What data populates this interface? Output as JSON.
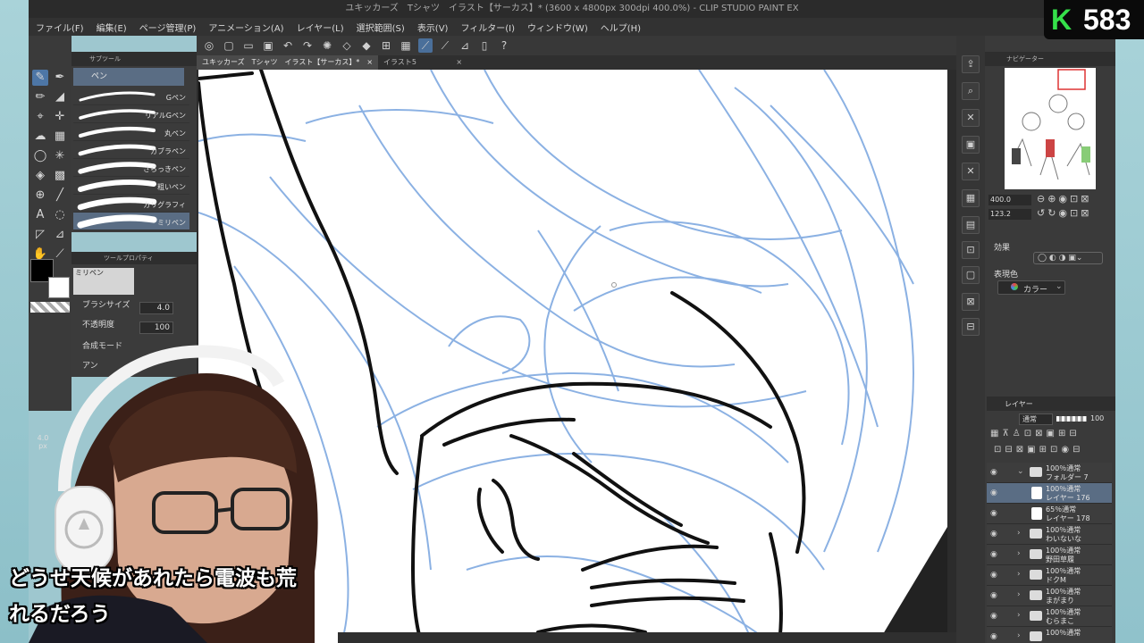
{
  "window": {
    "title": "ユキッカーズ　Tシャツ　イラスト【サーカス】* (3600 x 4800px 300dpi 400.0%)  - CLIP STUDIO PAINT EX"
  },
  "menu": [
    "ファイル(F)",
    "編集(E)",
    "ページ管理(P)",
    "アニメーション(A)",
    "レイヤー(L)",
    "選択範囲(S)",
    "表示(V)",
    "フィルター(I)",
    "ウィンドウ(W)",
    "ヘルプ(H)"
  ],
  "tabs": [
    {
      "label": "ユキッカーズ　Tシャツ　イラスト【サーカス】*",
      "close": "×"
    },
    {
      "label": "イラスト5",
      "close": "×"
    }
  ],
  "subtool": {
    "header": "サブツール",
    "group": "ペン",
    "brushes": [
      "Gペン",
      "リアルGペン",
      "丸ペン",
      "カブラペン",
      "さらっきペン",
      "粗いペン",
      "カリグラフィ",
      "ミリペン"
    ]
  },
  "toolprop": {
    "header": "ツールプロパティ",
    "preset": "ミリペン",
    "brush_size_label": "ブラシサイズ",
    "brush_size_value": "4.0",
    "opacity_label": "不透明度",
    "opacity_value": "100",
    "blend_label": "合成モード",
    "aa_label": "アン"
  },
  "size_readout": "4.0",
  "size_unit": "px",
  "navigator": {
    "header": "ナビゲーター",
    "zoom": "400.0",
    "rotate": "123.2"
  },
  "effects": {
    "header": "効果",
    "expression_label": "表現色",
    "expression_value": "カラー"
  },
  "layers_panel": {
    "header": "レイヤー",
    "blend_mode": "通常",
    "opacity": "100",
    "layers": [
      {
        "mode": "100％通常",
        "name": "フォルダー 7",
        "type": "folder",
        "expanded": true
      },
      {
        "mode": "100％通常",
        "name": "レイヤー 176",
        "type": "layer",
        "selected": true
      },
      {
        "mode": "65％通常",
        "name": "レイヤー 178",
        "type": "layer"
      },
      {
        "mode": "100％通常",
        "name": "わいないな",
        "type": "folder"
      },
      {
        "mode": "100％通常",
        "name": "野田草履",
        "type": "folder"
      },
      {
        "mode": "100％通常",
        "name": "ドクM",
        "type": "folder"
      },
      {
        "mode": "100％通常",
        "name": "まがまり",
        "type": "folder"
      },
      {
        "mode": "100％通常",
        "name": "むらまこ",
        "type": "folder"
      },
      {
        "mode": "100％通常",
        "name": "",
        "type": "folder"
      }
    ]
  },
  "badge": {
    "letter": "K",
    "number": "583"
  },
  "subtitle": {
    "line1": "どうせ天候があれたら電波も荒",
    "line2": "れるだろう"
  },
  "colors": {
    "sketch_blue": "#7fa9e0",
    "ink": "#111111",
    "accent": "#4d76a6",
    "badge_green": "#35e04a"
  }
}
